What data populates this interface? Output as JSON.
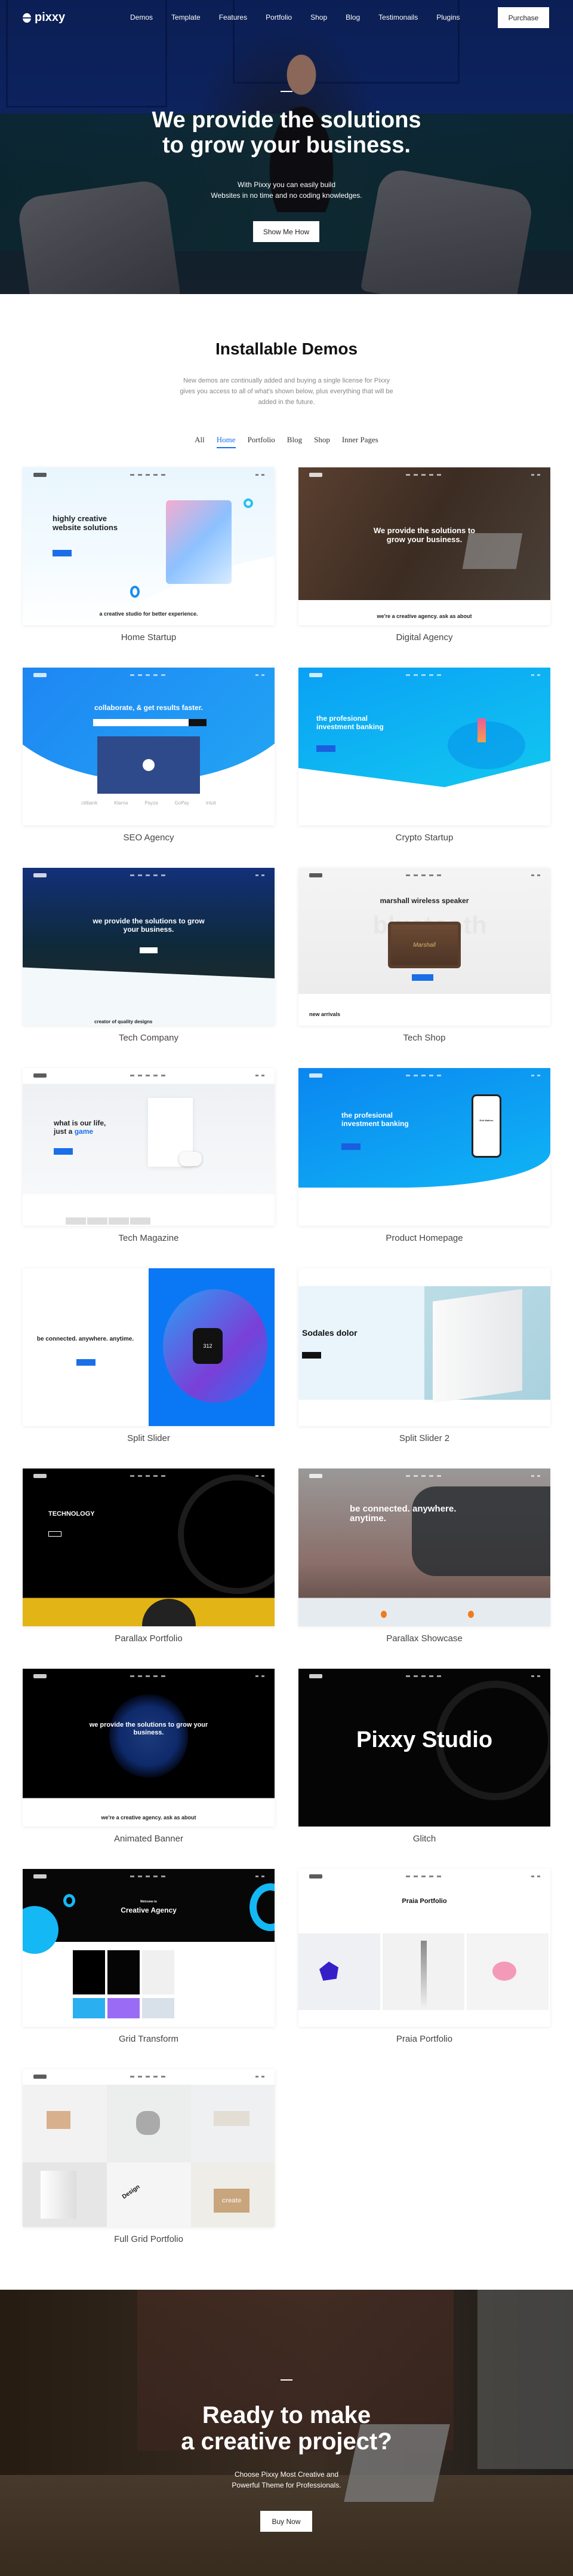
{
  "header": {
    "logo": "pixxy",
    "menu": [
      "Demos",
      "Template",
      "Features",
      "Portfolio",
      "Shop",
      "Blog",
      "Testimonails",
      "Plugins"
    ],
    "purchase_label": "Purchase"
  },
  "hero": {
    "headline_line1": "We provide the solutions",
    "headline_line2": "to grow your business.",
    "sub_line1": "With Pixxy you can easily build",
    "sub_line2": "Websites in no time and no coding knowledges.",
    "button_label": "Show Me How"
  },
  "demos": {
    "title": "Installable Demos",
    "description": "New demos are continually added and buying a single license for Pixxy gives you access to all of what's shown below, plus everything that will be added in the future.",
    "filters": [
      "All",
      "Home",
      "Portfolio",
      "Blog",
      "Shop",
      "Inner Pages"
    ],
    "active_filter": "Home",
    "cards": [
      {
        "label": "Home Startup",
        "theme": "startup",
        "headline": "highly creative website solutions",
        "footer": "a creative studio for better experience."
      },
      {
        "label": "Digital Agency",
        "theme": "agency",
        "headline": "We provide the solutions to grow your business.",
        "footer": "we're a creative agency. ask as about"
      },
      {
        "label": "SEO Agency",
        "theme": "seo",
        "headline": "collaborate, & get results faster.",
        "logos": [
          "citibank",
          "Klarna",
          "Payza",
          "GoPay",
          "intuit"
        ]
      },
      {
        "label": "Crypto Startup",
        "theme": "crypto",
        "headline": "the profesional investment banking"
      },
      {
        "label": "Tech Company",
        "theme": "techco",
        "headline": "we provide the solutions to grow your business.",
        "footer": "creator of quality designs"
      },
      {
        "label": "Tech Shop",
        "theme": "shop",
        "headline": "marshall wireless speaker",
        "watermark": "bluetooth",
        "footer": "new arrivals",
        "product": "Marshall"
      },
      {
        "label": "Tech Magazine",
        "theme": "magazine",
        "headline": "what is our life, just a",
        "highlight": "game"
      },
      {
        "label": "Product Homepage",
        "theme": "product",
        "headline": "the profesional investment banking",
        "profile": "Erik Walters"
      },
      {
        "label": "Split Slider",
        "theme": "split",
        "headline": "be connected. anywhere. anytime.",
        "watch": "312"
      },
      {
        "label": "Split Slider 2",
        "theme": "split2",
        "headline": "Sodales dolor"
      },
      {
        "label": "Parallax Portfolio",
        "theme": "parallax",
        "headline": "TECHNOLOGY"
      },
      {
        "label": "Parallax Showcase",
        "theme": "showcase",
        "headline": "be connected. anywhere. anytime."
      },
      {
        "label": "Animated Banner",
        "theme": "animated",
        "headline": "we provide the solutions to grow your business.",
        "footer": "we're a creative agency. ask as about"
      },
      {
        "label": "Glitch",
        "theme": "glitch",
        "headline": "Pixxy Studio"
      },
      {
        "label": "Grid Transform",
        "theme": "grid",
        "kicker": "Welcome to",
        "headline": "Creative Agency"
      },
      {
        "label": "Praia Portfolio",
        "theme": "praia",
        "headline": "Praia Portfolio"
      },
      {
        "label": "Full Grid Portfolio",
        "theme": "fullgrid",
        "tile_text": [
          "Design",
          "create"
        ]
      }
    ]
  },
  "cta": {
    "headline_line1": "Ready to make",
    "headline_line2": "a creative project?",
    "sub_line1": "Choose Pixxy Most Creative and",
    "sub_line2": "Powerful Theme for Professionals.",
    "button_label": "Buy Now"
  },
  "colors": {
    "accent": "#1a6fe8",
    "hero_bg": "#13307a",
    "text": "#222222"
  }
}
